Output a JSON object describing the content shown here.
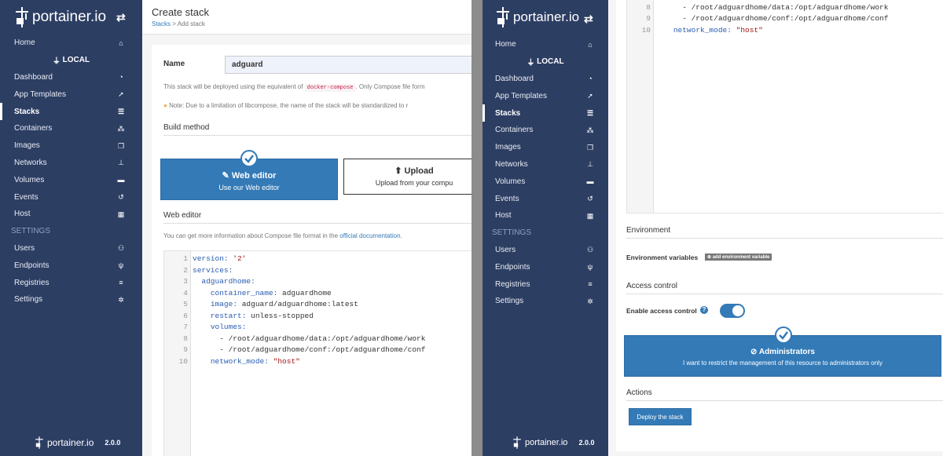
{
  "brand": {
    "name": "portainer.io",
    "version": "2.0.0"
  },
  "sidebar": {
    "home": "Home",
    "endpoint": "LOCAL",
    "items": [
      "Dashboard",
      "App Templates",
      "Stacks",
      "Containers",
      "Images",
      "Networks",
      "Volumes",
      "Events",
      "Host"
    ],
    "active": "Stacks",
    "settings_header": "SETTINGS",
    "settings_items": [
      "Users",
      "Endpoints",
      "Registries",
      "Settings"
    ]
  },
  "page": {
    "title": "Create stack",
    "breadcrumb_link": "Stacks",
    "breadcrumb_rest": "> Add stack"
  },
  "form": {
    "name_label": "Name",
    "name_value": "adguard",
    "info_pre": "This stack will be deployed using the equivalent of",
    "info_code": "docker-compose",
    "info_post": ". Only Compose file form",
    "note": "Note: Due to a limitation of libcompose, the name of the stack will be standardized to r",
    "build_method": "Build method",
    "web_editor_title": "Web editor",
    "web_editor_sub": "Use our Web editor",
    "upload_title": "Upload",
    "upload_sub": "Upload from your compu",
    "web_editor_section": "Web editor",
    "editor_info_pre": "You can get more information about Compose file format in the",
    "editor_info_link": "official documentation",
    "editor_info_post": "."
  },
  "code": [
    {
      "n": "1",
      "t": "version: '2'"
    },
    {
      "n": "2",
      "t": "services:"
    },
    {
      "n": "3",
      "t": "  adguardhome:"
    },
    {
      "n": "4",
      "t": "    container_name: adguardhome"
    },
    {
      "n": "5",
      "t": "    image: adguard/adguardhome:latest"
    },
    {
      "n": "6",
      "t": "    restart: unless-stopped"
    },
    {
      "n": "7",
      "t": "    volumes:"
    },
    {
      "n": "8",
      "t": "      - /root/adguardhome/data:/opt/adguardhome/work"
    },
    {
      "n": "9",
      "t": "      - /root/adguardhome/conf:/opt/adguardhome/conf"
    },
    {
      "n": "10",
      "t": "    network_mode: \"host\""
    }
  ],
  "right": {
    "environment": "Environment",
    "env_vars": "Environment variables",
    "add_env": "add environment variable",
    "access_control": "Access control",
    "enable_access": "Enable access control",
    "admins_title": "Administrators",
    "admins_sub": "I want to restrict the management of this resource to administrators only",
    "actions": "Actions",
    "deploy": "Deploy the stack"
  }
}
